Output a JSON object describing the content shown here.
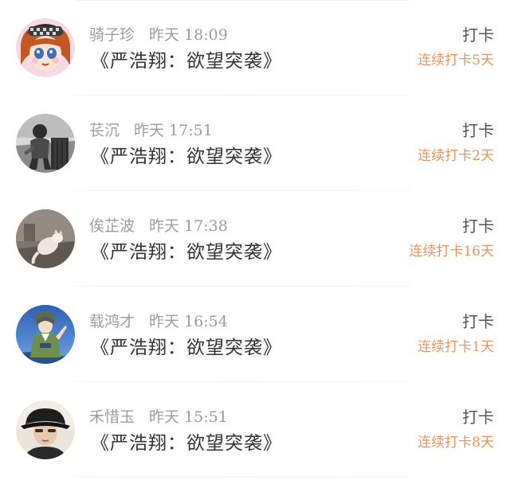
{
  "accent_color": "#e8955a",
  "action_label": "打卡",
  "entries": [
    {
      "name": "骑子珍",
      "time": "昨天 18:09",
      "book": "《严浩翔：欲望突袭》",
      "streak": "连续打卡5天",
      "avatar_icon": "doll-avatar-icon"
    },
    {
      "name": "苌沉",
      "time": "昨天 17:51",
      "book": "《严浩翔：欲望突袭》",
      "streak": "连续打卡2天",
      "avatar_icon": "bw-photo-avatar-icon"
    },
    {
      "name": "俟芷波",
      "time": "昨天 17:38",
      "book": "《严浩翔：欲望突袭》",
      "streak": "连续打卡16天",
      "avatar_icon": "cat-avatar-icon"
    },
    {
      "name": "载鸿才",
      "time": "昨天 16:54",
      "book": "《严浩翔：欲望突袭》",
      "streak": "连续打卡1天",
      "avatar_icon": "anime-boy-avatar-icon"
    },
    {
      "name": "禾惜玉",
      "time": "昨天 15:51",
      "book": "《严浩翔：欲望突袭》",
      "streak": "连续打卡8天",
      "avatar_icon": "person-hat-avatar-icon"
    }
  ]
}
